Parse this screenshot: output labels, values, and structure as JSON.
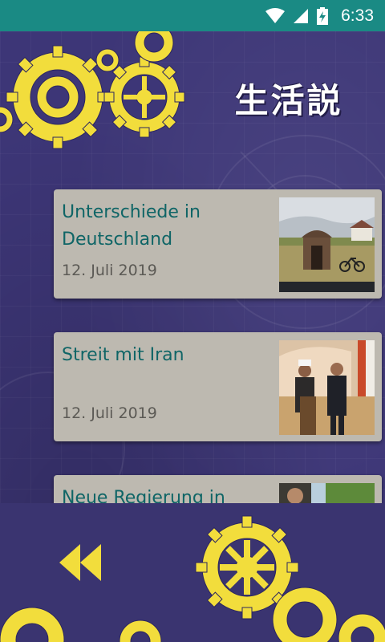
{
  "status_bar": {
    "time": "6:33"
  },
  "app": {
    "title": "生活説"
  },
  "articles": [
    {
      "title": "Unterschiede in Deutschland",
      "date": "12. Juli 2019"
    },
    {
      "title": "Streit mit Iran",
      "date": "12. Juli 2019"
    },
    {
      "title": "Neue Regierung in",
      "date": ""
    }
  ],
  "colors": {
    "status_bar": "#1a8a84",
    "background": "#3d3677",
    "card": "#bdb9b0",
    "title_text": "#0f6566",
    "gear_yellow": "#f2dd3c"
  },
  "icons": [
    "wifi-icon",
    "signal-icon",
    "battery-charging-icon",
    "gear-icon",
    "rewind-icon"
  ]
}
